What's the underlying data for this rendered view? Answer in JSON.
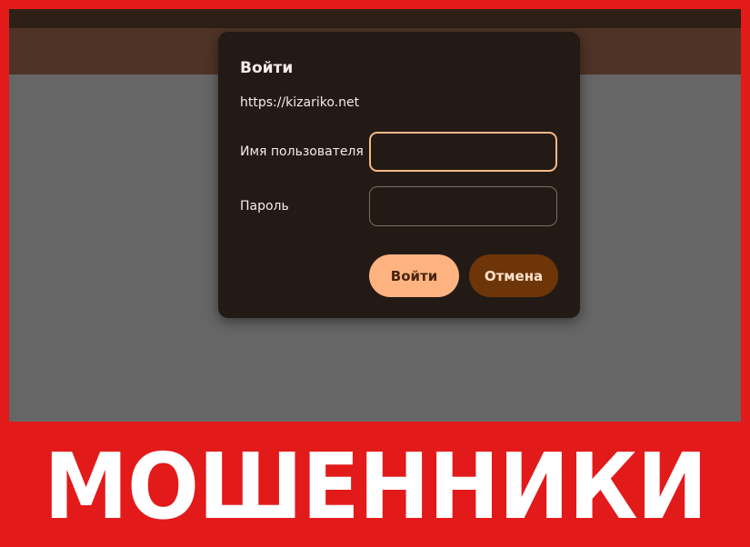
{
  "dialog": {
    "title": "Войти",
    "url": "https://kizariko.net",
    "username_label": "Имя пользователя",
    "password_label": "Пароль",
    "username_value": "",
    "password_value": "",
    "login_button": "Войти",
    "cancel_button": "Отмена"
  },
  "banner": {
    "text": "МОШЕННИКИ"
  },
  "colors": {
    "frame_red": "#e31a1a",
    "dialog_bg": "#231a16",
    "accent_peach": "#ffb380",
    "cancel_brown": "#6e3608"
  }
}
